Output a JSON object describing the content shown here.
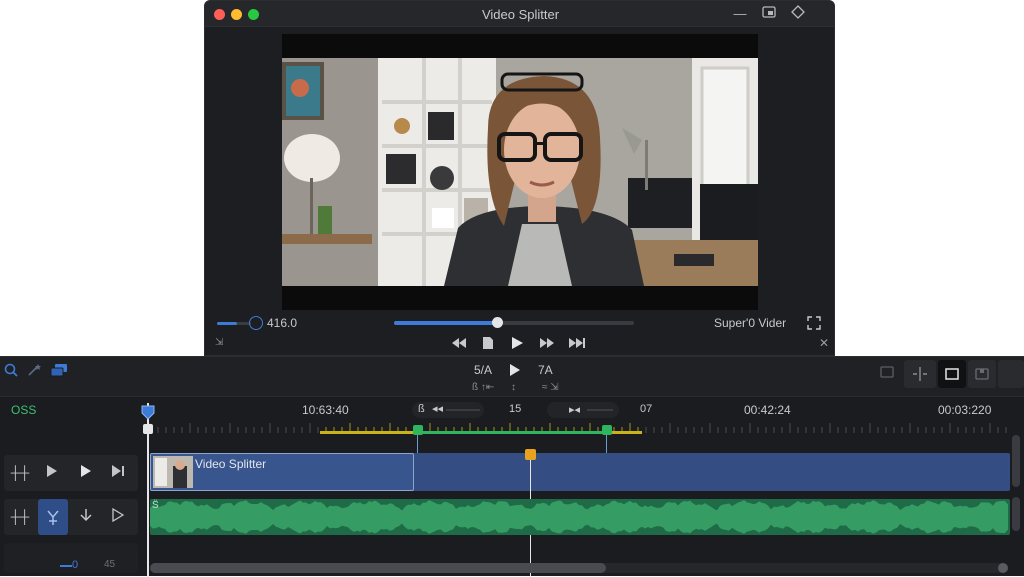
{
  "window": {
    "title": "Video Splitter"
  },
  "player": {
    "time_display": "416.0",
    "right_label": "Super'0 Vider",
    "progress": 0.43,
    "volume": 0.6
  },
  "toolbar": {
    "center_top_left": "5/A",
    "center_top_right": "7A",
    "center_bottom_left": "ß ↑⇤",
    "center_bottom_mid": "↕",
    "center_bottom_right": "≈ ⇲"
  },
  "timeline": {
    "left_label": "OSS",
    "ticks": [
      "10:63:40",
      "15",
      "07",
      "00:42:24",
      "00:03:220"
    ],
    "seg_left": "ß",
    "seg_right": "▸◂",
    "clip_label": "Video Splitter",
    "audio_label": "S̈",
    "bottom_left_value": "0",
    "bottom_right_value": "45"
  },
  "colors": {
    "accent": "#3d7bd8",
    "clip": "#344e83",
    "audio": "#1f6b47",
    "marker_green": "#2fb55d",
    "marker_orange": "#e8a21d",
    "range_yellow": "#c9b21a"
  },
  "icons": {
    "search": "search-icon",
    "wand": "magic-wand-icon",
    "layers": "layers-icon",
    "play": "play-icon",
    "rewind": "rewind-icon",
    "forward": "fast-forward-icon"
  }
}
